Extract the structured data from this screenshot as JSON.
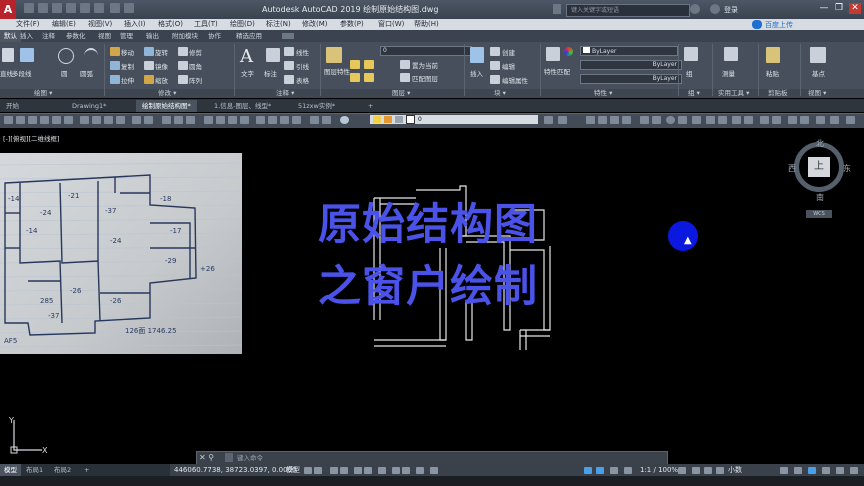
{
  "title_bar": {
    "app_button": "A",
    "title": "Autodesk AutoCAD 2019    绘制原始结构图.dwg",
    "search_placeholder": "键入关键字或短语",
    "login": "登录",
    "min": "—",
    "restore": "❐",
    "close": "✕"
  },
  "menu_bar": {
    "items": [
      "文件(F)",
      "编辑(E)",
      "视图(V)",
      "插入(I)",
      "格式(O)",
      "工具(T)",
      "绘图(D)",
      "标注(N)",
      "修改(M)",
      "参数(P)",
      "窗口(W)",
      "帮助(H)"
    ],
    "baidu": "百度上传"
  },
  "ribbon_tabs": [
    "默认",
    "插入",
    "注释",
    "参数化",
    "视图",
    "管理",
    "输出",
    "附加模块",
    "协作",
    "精选应用"
  ],
  "ribbon": {
    "draw": {
      "line": "直线",
      "polyline": "多段线",
      "circle": "圆",
      "arc": "圆弧"
    },
    "modify": {
      "move": "移动",
      "rotate": "旋转",
      "trim": "修剪",
      "copy": "复制",
      "mirror": "镜像",
      "fillet": "圆角",
      "stretch": "拉伸",
      "scale": "缩放",
      "array": "阵列"
    },
    "annotation": {
      "text": "文字",
      "dimension": "标注",
      "linear": "线性",
      "leader": "引线",
      "table": "表格"
    },
    "layers": {
      "layer_props": "图层特性",
      "current_layer": "0",
      "make_current": "置为当前",
      "match_layer": "匹配图层"
    },
    "block": {
      "insert": "插入",
      "create": "创建",
      "edit": "编辑",
      "edit_attr": "编辑属性"
    },
    "properties": {
      "match": "特性匹配",
      "bylayer1": "ByLayer",
      "bylayer2": "ByLayer",
      "bylayer3": "ByLayer"
    },
    "groups": {
      "group": "组"
    },
    "utilities": {
      "measure": "测量"
    },
    "clipboard": {
      "paste": "粘贴"
    },
    "view": {
      "base": "基点"
    }
  },
  "panel_titles": [
    "绘图 ▾",
    "修改 ▾",
    "注释 ▾",
    "图层 ▾",
    "块 ▾",
    "特性 ▾",
    "组 ▾",
    "实用工具 ▾",
    "剪贴板",
    "视图 ▾"
  ],
  "file_tabs": [
    "开始",
    "Drawing1*",
    "绘制原始结构图*",
    "1.信息-图层、线型*",
    "51zxw实例*"
  ],
  "toolbar": {
    "layer_value": "0"
  },
  "viewport": {
    "label": "[-][俯视][二维线框]",
    "overlay_line1": "原始结构图",
    "overlay_line2": "之窗户绘制",
    "viewcube": {
      "north": "北",
      "south": "南",
      "east": "东",
      "west": "西",
      "top": "上",
      "wcs": "WCS"
    },
    "ucs_x": "X",
    "ucs_y": "Y"
  },
  "command_line": {
    "prompt": "键入命令"
  },
  "layout_tabs": [
    "模型",
    "布局1",
    "布局2",
    "+"
  ],
  "status_bar": {
    "coords": "446060.7738, 38723.0397, 0.0000",
    "model": "模型",
    "scale": "1:1 / 100%",
    "units": "小数"
  },
  "colors": {
    "overlay_text": "#4a52e8",
    "cursor_highlight": "#0b18e0",
    "app_red": "#b8222a"
  }
}
